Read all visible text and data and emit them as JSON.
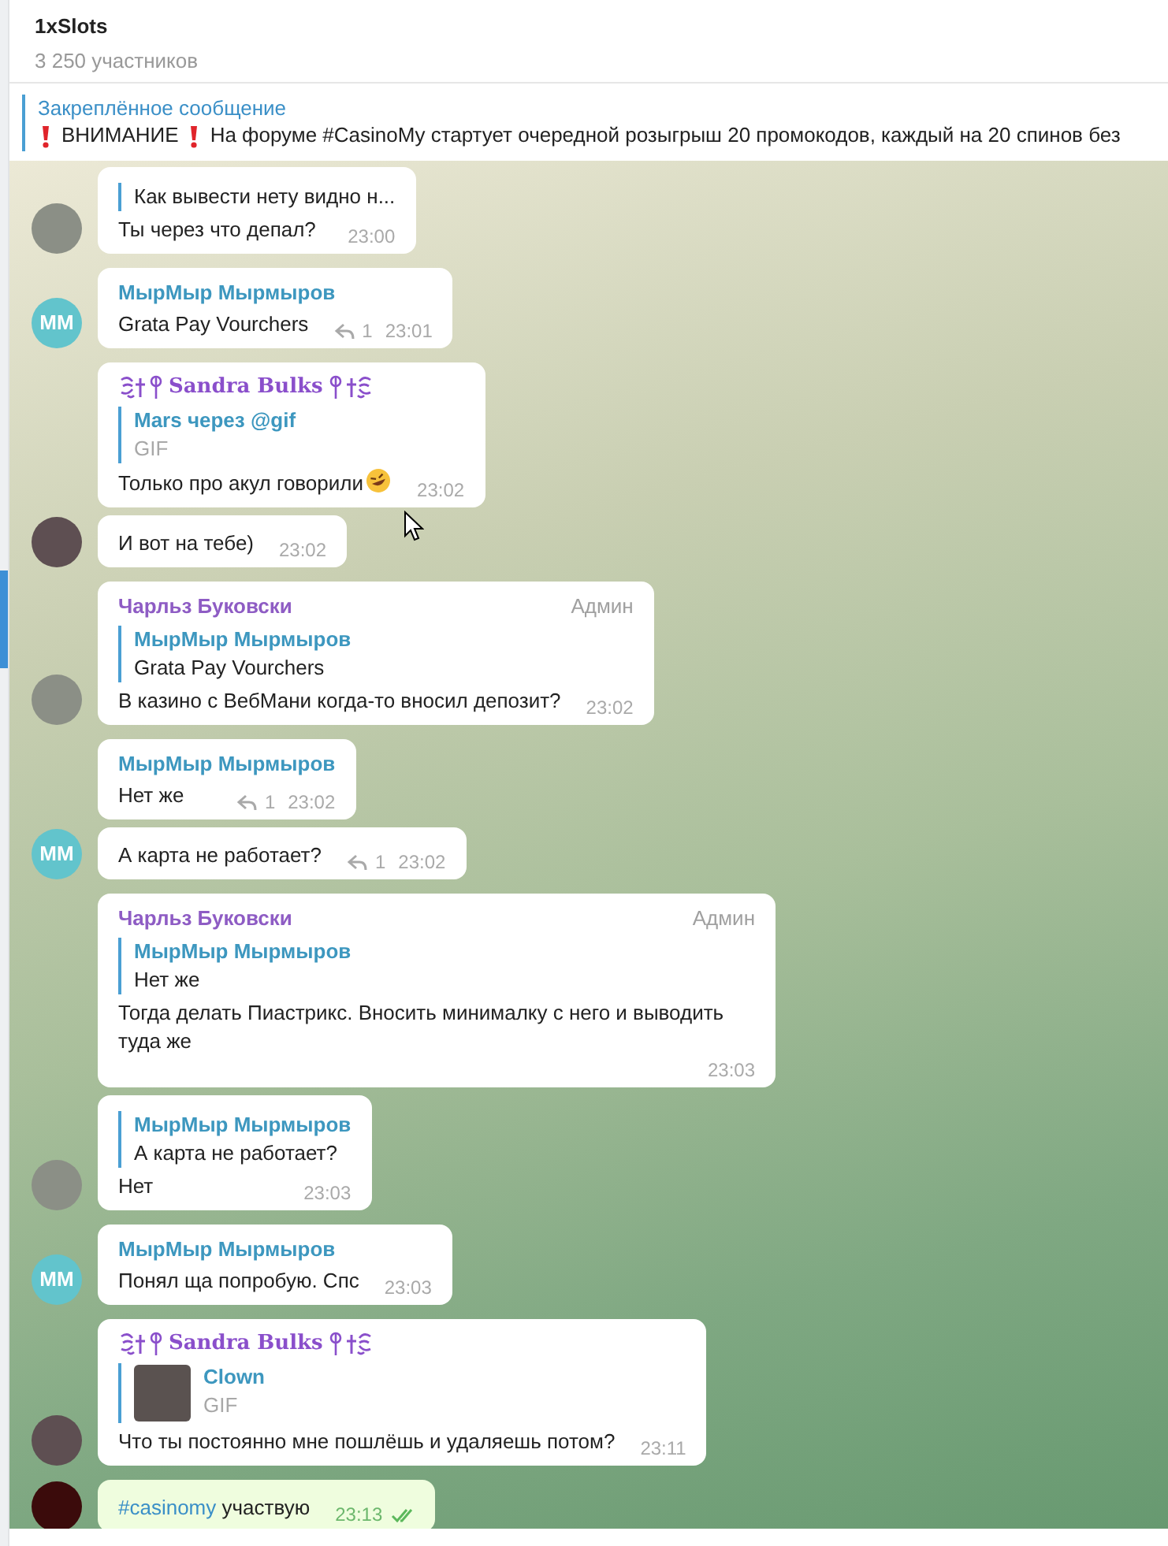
{
  "header": {
    "title": "1xSlots",
    "subtitle": "3 250 участников"
  },
  "pinned": {
    "title": "Закреплённое сообщение",
    "parts": [
      {
        "kind": "alert"
      },
      {
        "kind": "text",
        "text": "ВНИМАНИЕ"
      },
      {
        "kind": "alert"
      },
      {
        "kind": "text",
        "text": "На форуме #CasinoMy стартует очередной розыгрыш 20 промокодов, каждый на 20 спинов без"
      }
    ]
  },
  "groups": [
    {
      "avatar": {
        "kind": "photo",
        "color": "#8b8f86"
      },
      "messages": [
        {
          "reply": {
            "text": "Как вывести нету видно н..."
          },
          "text": "Ты через что депал?",
          "time": "23:00"
        }
      ]
    },
    {
      "avatar": {
        "kind": "initials",
        "text": "MM",
        "color": "#62c4cc"
      },
      "messages": [
        {
          "author": {
            "kind": "plain",
            "name": "МырМыр Мырмыров",
            "color": "#3d97bf"
          },
          "text": "Grata Pay Vourchers",
          "replies": "1",
          "time": "23:01"
        }
      ]
    },
    {
      "avatar": {
        "kind": "photo",
        "color": "#5e4f52"
      },
      "messages": [
        {
          "author": {
            "kind": "fancy",
            "name": "Sandra Bulks",
            "color": "#8a4fcb"
          },
          "reply": {
            "kind": "media",
            "name": "Mars через @gif",
            "text": "GIF"
          },
          "text": "Только про акул говорили",
          "trailing_emoji": true,
          "time": "23:02"
        },
        {
          "text": "И вот на тебе)",
          "time": "23:02"
        }
      ]
    },
    {
      "avatar": {
        "kind": "photo",
        "color": "#8b8f86"
      },
      "messages": [
        {
          "author": {
            "kind": "plain",
            "name": "Чарльз Буковски",
            "color": "#8e5cc4",
            "badge": "Админ"
          },
          "reply": {
            "name": "МырМыр Мырмыров",
            "text": "Grata Pay Vourchers"
          },
          "text": "В казино с ВебМани когда-то вносил депозит?",
          "time": "23:02"
        }
      ]
    },
    {
      "avatar": {
        "kind": "initials",
        "text": "MM",
        "color": "#62c4cc"
      },
      "messages": [
        {
          "author": {
            "kind": "plain",
            "name": "МырМыр Мырмыров",
            "color": "#3d97bf"
          },
          "text": "Нет же",
          "replies": "1",
          "time": "23:02"
        },
        {
          "text": "А карта не работает?",
          "replies": "1",
          "time": "23:02"
        }
      ]
    },
    {
      "avatar": {
        "kind": "photo",
        "color": "#8b8f86"
      },
      "messages": [
        {
          "author": {
            "kind": "plain",
            "name": "Чарльз Буковски",
            "color": "#8e5cc4",
            "badge": "Админ"
          },
          "reply": {
            "name": "МырМыр Мырмыров",
            "text": "Нет же"
          },
          "text": "Тогда делать Пиастрикс. Вносить минималку с него и выводить туда же",
          "time": "23:03"
        },
        {
          "reply": {
            "name": "МырМыр Мырмыров",
            "text": "А карта не работает?"
          },
          "text": "Нет",
          "time": "23:03"
        }
      ]
    },
    {
      "avatar": {
        "kind": "initials",
        "text": "MM",
        "color": "#62c4cc"
      },
      "messages": [
        {
          "author": {
            "kind": "plain",
            "name": "МырМыр Мырмыров",
            "color": "#3d97bf"
          },
          "text": "Понял ща попробую. Спс",
          "time": "23:03"
        }
      ]
    },
    {
      "avatar": {
        "kind": "photo",
        "color": "#5e4f52"
      },
      "messages": [
        {
          "author": {
            "kind": "fancy",
            "name": "Sandra Bulks",
            "color": "#8a4fcb"
          },
          "reply": {
            "kind": "media",
            "name": "Clown",
            "text": "GIF",
            "thumbnail": true
          },
          "text": "Что ты постоянно мне пошлёшь и удаляешь потом?",
          "time": "23:11"
        }
      ]
    },
    {
      "avatar": {
        "kind": "photo",
        "color": "#3b0b0b"
      },
      "messages": [
        {
          "outgoing": true,
          "hashtag": "#casinomy",
          "text": "участвую",
          "time": "23:13",
          "read": true
        }
      ]
    }
  ]
}
